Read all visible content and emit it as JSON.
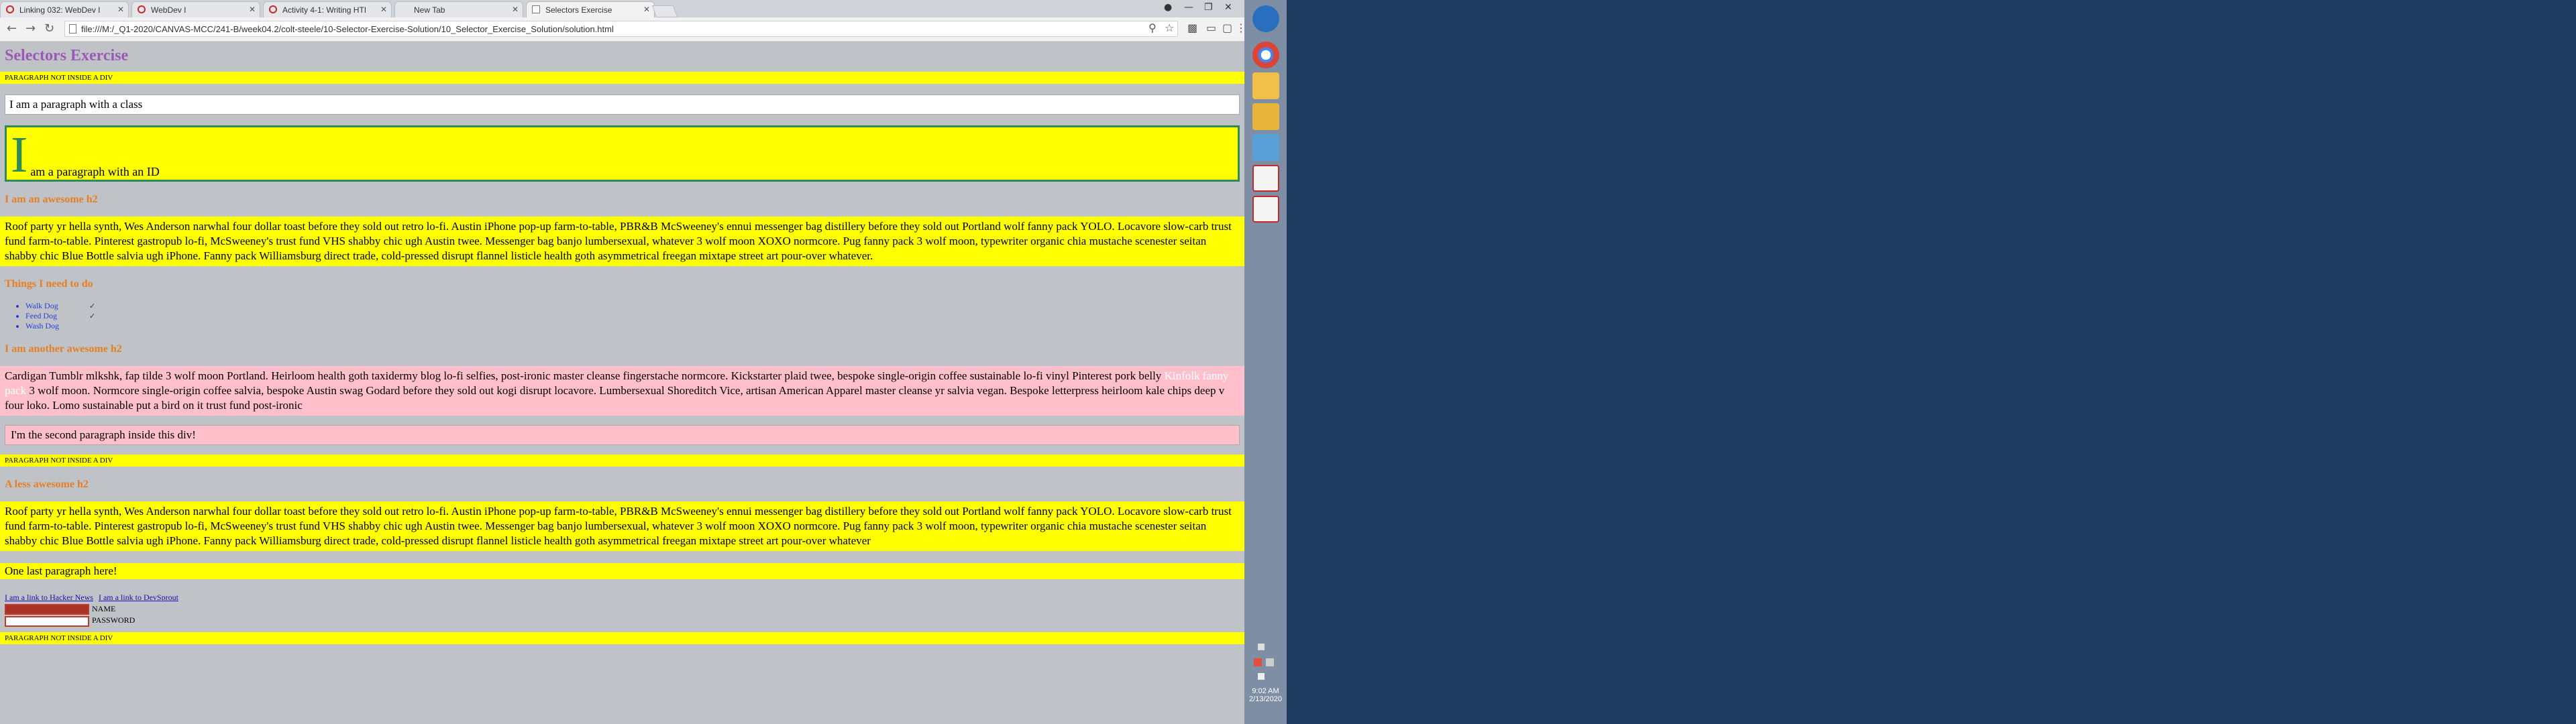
{
  "browser": {
    "tabs": [
      {
        "label": "Linking 032: WebDev I",
        "icon": "error-circle-icon"
      },
      {
        "label": "WebDev I",
        "icon": "error-circle-icon"
      },
      {
        "label": "Activity 4-1: Writing HTI",
        "icon": "error-circle-icon"
      },
      {
        "label": "New Tab",
        "icon": "none"
      },
      {
        "label": "Selectors Exercise",
        "icon": "document-icon",
        "active": true
      }
    ],
    "url": "file:///M:/_Q1-2020/CANVAS-MCC/241-B/week04.2/colt-steele/10-Selector-Exercise-Solution/10_Selector_Exercise_Solution/solution.html"
  },
  "page": {
    "title": "Selectors Exercise",
    "not_in_div_1": "PARAGRAPH NOT INSIDE A DIV",
    "class_paragraph": "I am a paragraph with a class",
    "id_first_letter": "I",
    "id_rest": "am a paragraph with an ID",
    "h2_awesome": "I am an awesome h2",
    "lorem_1": "Roof party yr hella synth, Wes Anderson narwhal four dollar toast before they sold out retro lo-fi. Austin iPhone pop-up farm-to-table, PBR&B McSweeney's ennui messenger bag distillery before they sold out Portland wolf fanny pack YOLO. Locavore slow-carb trust fund farm-to-table. Pinterest gastropub lo-fi, McSweeney's trust fund VHS shabby chic ugh Austin twee. Messenger bag banjo lumbersexual, whatever 3 wolf moon XOXO normcore. Pug fanny pack 3 wolf moon, typewriter organic chia mustache scenester seitan shabby chic Blue Bottle salvia ugh iPhone. Fanny pack Williamsburg direct trade, cold-pressed disrupt flannel listicle health goth asymmetrical freegan mixtape street art pour-over whatever.",
    "h2_things": "Things I need to do",
    "todo": [
      {
        "label": "Walk Dog",
        "checked": true
      },
      {
        "label": "Feed Dog",
        "checked": true
      },
      {
        "label": "Wash Dog",
        "checked": false
      }
    ],
    "checkmark": "✓",
    "h2_another": "I am another awesome h2",
    "pink_start": "Cardigan Tumblr mlkshk, fap tilde 3 wolf moon Portland. Heirloom health goth taxidermy blog lo-fi selfies, post-ironic master cleanse fingerstache normcore. Kickstarter plaid twee, bespoke single-origin coffee sustainable lo-fi vinyl Pinterest pork belly",
    "pink_hidden": " Kinfolk fanny pack ",
    "pink_end": "3 wolf moon. Normcore single-origin coffee salvia, bespoke Austin swag Godard before they sold out kogi disrupt locavore. Lumbersexual Shoreditch Vice, artisan American Apparel master cleanse yr salvia vegan. Bespoke letterpress heirloom kale chips deep v four loko. Lomo sustainable put a bird on it trust fund post-ironic",
    "second_para": "I'm the second paragraph inside this div!",
    "not_in_div_2": "PARAGRAPH NOT INSIDE A DIV",
    "h2_less": "A less awesome h2",
    "lorem_2": "Roof party yr hella synth, Wes Anderson narwhal four dollar toast before they sold out retro lo-fi. Austin iPhone pop-up farm-to-table, PBR&B McSweeney's ennui messenger bag distillery before they sold out Portland wolf fanny pack YOLO. Locavore slow-carb trust fund farm-to-table. Pinterest gastropub lo-fi, McSweeney's trust fund VHS shabby chic ugh Austin twee. Messenger bag banjo lumbersexual, whatever 3 wolf moon XOXO normcore. Pug fanny pack 3 wolf moon, typewriter organic chia mustache scenester seitan shabby chic Blue Bottle salvia ugh iPhone. Fanny pack Williamsburg direct trade, cold-pressed disrupt flannel listicle health goth asymmetrical freegan mixtape street art pour-over whatever",
    "last_para": "One last paragraph here!",
    "link_hn": "I am a link to Hacker News",
    "link_ds": "I am a link to DevSprout",
    "name_label": "NAME",
    "password_label": "PASSWORD",
    "not_in_div_3": "PARAGRAPH NOT INSIDE A DIV"
  },
  "taskbar": {
    "clock_time": "9:02 AM",
    "clock_date": "2/13/2020"
  }
}
